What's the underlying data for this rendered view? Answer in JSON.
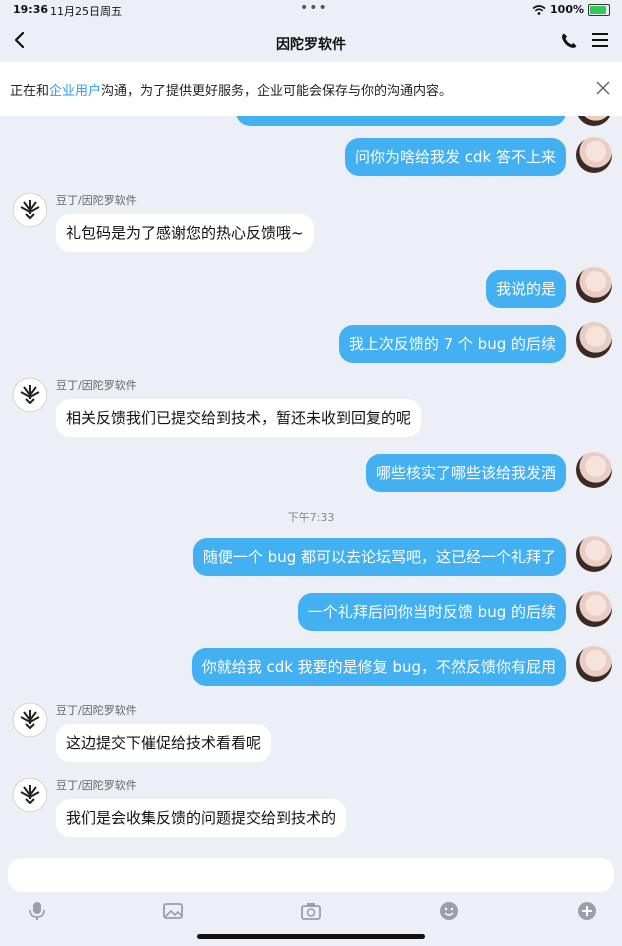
{
  "status": {
    "time": "19:36",
    "date": "11月25日周五",
    "battery": "100%",
    "battery_level": 1.0
  },
  "header": {
    "title": "因陀罗软件",
    "icons": [
      "back-icon",
      "phone-icon",
      "menu-icon"
    ]
  },
  "notice": {
    "prefix": "正在和",
    "link": "企业用户",
    "suffix": "沟通，为了提供更好服务，企业可能会保存与你的沟通内容。"
  },
  "chat": {
    "timestamp": "下午7:33",
    "messages": [
      {
        "from": "user",
        "text": "问你为啥给我发 cdk 答不上来"
      },
      {
        "from": "bot",
        "sender": "豆丁/因陀罗软件",
        "text": "礼包码是为了感谢您的热心反馈哦~"
      },
      {
        "from": "user",
        "text": "我说的是"
      },
      {
        "from": "user",
        "text": "我上次反馈的 7 个 bug 的后续"
      },
      {
        "from": "bot",
        "sender": "豆丁/因陀罗软件",
        "text": "相关反馈我们已提交给到技术，暂还未收到回复的呢"
      },
      {
        "from": "user",
        "text": "哪些核实了哪些该给我发酒"
      },
      {
        "from": "user",
        "text": "随便一个 bug 都可以去论坛骂吧，这已经一个礼拜了"
      },
      {
        "from": "user",
        "text": "一个礼拜后问你当时反馈 bug 的后续"
      },
      {
        "from": "user",
        "text": "你就给我 cdk 我要的是修复 bug，不然反馈你有屁用"
      },
      {
        "from": "bot",
        "sender": "豆丁/因陀罗软件",
        "text": "这边提交下催促给技术看看呢"
      },
      {
        "from": "bot",
        "sender": "豆丁/因陀罗软件",
        "text": "我们是会收集反馈的问题提交给到技术的"
      }
    ]
  },
  "input": {
    "placeholder": ""
  },
  "toolbar": {
    "icons": [
      "microphone-icon",
      "image-icon",
      "camera-icon",
      "emoji-icon",
      "plus-icon"
    ]
  },
  "colors": {
    "outgoing_bubble": "#43b0f1",
    "incoming_bubble": "#ffffff",
    "background": "#eceff6",
    "link": "#2aa1e8",
    "battery": "#35c759"
  }
}
